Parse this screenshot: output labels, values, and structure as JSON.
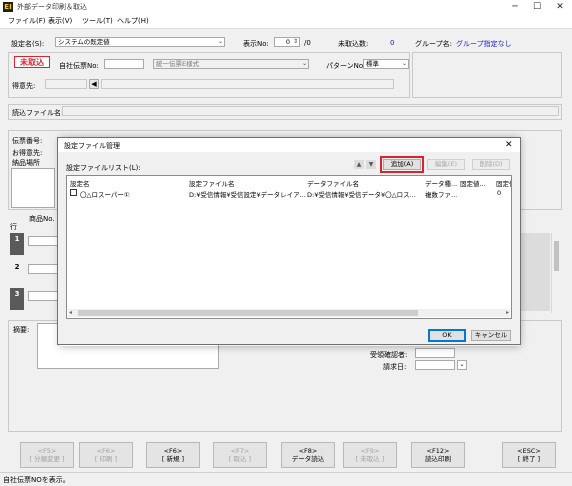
{
  "window": {
    "title": "外部データ印刷＆取込",
    "app_icon_text": "EI",
    "controls": {
      "minimize": "─",
      "maximize": "☐",
      "close": "✕"
    }
  },
  "menu": [
    {
      "label": "ファイル(F)"
    },
    {
      "label": "表示(V)"
    },
    {
      "label": "ツール(T)"
    },
    {
      "label": "ヘルプ(H)"
    }
  ],
  "header": {
    "settings_label": "設定名(S):",
    "settings_value": "システムの既定値",
    "display_no_label": "表示No:",
    "display_no_value": "0",
    "display_no_total": "/0",
    "unimported_label": "未取込数:",
    "unimported_value": "0",
    "group_label": "グループ名:",
    "group_value": "グループ指定なし"
  },
  "form": {
    "status_badge": "未取込",
    "company_slip_label": "自社伝票No:",
    "slip_format_value": "統一伝票E様式",
    "pattern_label": "パターンNo:",
    "pattern_value": "標準",
    "customer_label": "得意先:",
    "file_label": "読込ファイル名:",
    "slip_no_label": "伝票番号:",
    "customer2_label": "お得意先:",
    "delivery_label": "納品場所",
    "row_label": "行",
    "product_label": "商品No.",
    "rows": [
      "1",
      "2",
      "3"
    ],
    "summary_label": "摘要:",
    "receiver_label": "受領確認者:",
    "billing_date_label": "請求日:"
  },
  "dialog": {
    "title": "設定ファイル管理",
    "close": "✕",
    "list_label": "設定ファイルリスト(L):",
    "up_arrow": "▲",
    "down_arrow": "▼",
    "add_button": "追加(A)",
    "edit_button": "編集(E)",
    "delete_button": "削除(D)",
    "columns": [
      "設定名",
      "設定ファイル名",
      "データファイル名",
      "データ種...",
      "固定値...",
      "固定値"
    ],
    "rows": [
      {
        "name": "〇△ロスーパー①",
        "settings_file": "D:¥受信情報¥受信設定¥データレイア...",
        "data_file": "D:¥受信情報¥受信データ¥〇△ロス...",
        "data_type": "複数ファ...",
        "fixed1": "",
        "fixed2": "0"
      }
    ],
    "ok_button": "OK",
    "cancel_button": "キャンセル",
    "highlight_color": "#d9232d"
  },
  "function_keys": [
    {
      "key": "<F5>",
      "label": "[ 分類変更 ]",
      "enabled": false
    },
    {
      "key": "<F6>",
      "label": "[ 印刷 ]",
      "enabled": false
    },
    {
      "key": "<F6>",
      "label": "[ 新規 ]",
      "enabled": true
    },
    {
      "key": "<F7>",
      "label": "[ 取込 ]",
      "enabled": false
    },
    {
      "key": "<F8>",
      "label": "データ読込",
      "enabled": true
    },
    {
      "key": "<F9>",
      "label": "[ 未取込 ]",
      "enabled": false
    },
    {
      "key": "<F12>",
      "label": "読込印刷",
      "enabled": true
    },
    {
      "key": "<ESC>",
      "label": "[ 終了 ]",
      "enabled": true
    }
  ],
  "status_bar": "自社伝票NOを表示。",
  "colors": {
    "status_red": "#d9232d",
    "blue_value": "#1a1acc"
  }
}
